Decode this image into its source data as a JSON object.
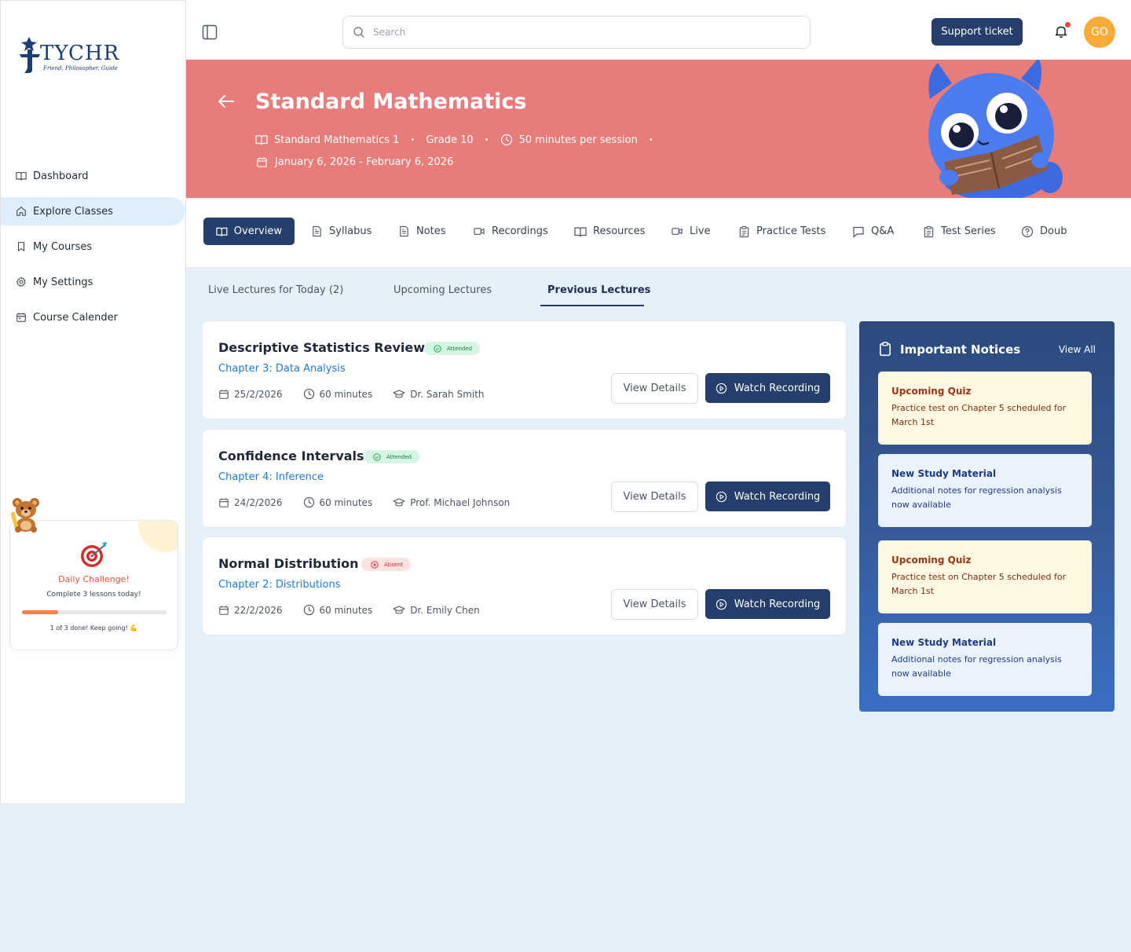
{
  "brand": {
    "name": "TYCHR",
    "tagline": "Friend, Philosopher, Guide"
  },
  "sidebar": {
    "items": [
      {
        "label": "Dashboard",
        "icon": "book-open-icon",
        "active": false
      },
      {
        "label": "Explore Classes",
        "icon": "home-icon",
        "active": true
      },
      {
        "label": "My Courses",
        "icon": "bookmark-icon",
        "active": false
      },
      {
        "label": "My Settings",
        "icon": "gear-icon",
        "active": false
      },
      {
        "label": "Course Calender",
        "icon": "calendar-icon",
        "active": false
      }
    ],
    "challenge": {
      "title": "Daily Challenge!",
      "subtitle": "Complete 3 lessons today!",
      "progress_fraction": 0.25,
      "progress_text": "1 of 3 done! Keep going! 💪"
    }
  },
  "topbar": {
    "search_placeholder": "Search",
    "support_label": "Support ticket",
    "avatar_initials": "GO",
    "notification_dot_color": "#ef4444"
  },
  "hero": {
    "title": "Standard Mathematics",
    "course": "Standard Mathematics 1",
    "grade": "Grade 10",
    "session": "50 minutes per session",
    "date_range": "January 6, 2026 - February 6, 2026",
    "background_color": "#e87c7b"
  },
  "tabs": [
    {
      "label": "Overview",
      "icon": "book-open-icon",
      "active": true
    },
    {
      "label": "Syllabus",
      "icon": "document-icon",
      "active": false
    },
    {
      "label": "Notes",
      "icon": "document-icon",
      "active": false
    },
    {
      "label": "Recordings",
      "icon": "video-icon",
      "active": false
    },
    {
      "label": "Resources",
      "icon": "book-open-icon",
      "active": false
    },
    {
      "label": "Live",
      "icon": "video-icon",
      "active": false
    },
    {
      "label": "Practice Tests",
      "icon": "clipboard-icon",
      "active": false
    },
    {
      "label": "Q&A",
      "icon": "chat-icon",
      "active": false
    },
    {
      "label": "Test Series",
      "icon": "clipboard-icon",
      "active": false
    },
    {
      "label": "Doub",
      "icon": "question-icon",
      "active": false
    }
  ],
  "subtabs": [
    {
      "label": "Live Lectures for Today (2)",
      "active": false
    },
    {
      "label": "Upcoming Lectures",
      "active": false
    },
    {
      "label": "Previous Lectures",
      "active": true
    }
  ],
  "lectures": [
    {
      "title": "Descriptive Statistics Review",
      "status": "Attended",
      "chapter": "Chapter 3: Data Analysis",
      "date": "25/2/2026",
      "duration": "60 minutes",
      "instructor": "Dr. Sarah Smith"
    },
    {
      "title": "Confidence Intervals",
      "status": "Attended",
      "chapter": "Chapter 4: Inference",
      "date": "24/2/2026",
      "duration": "60 minutes",
      "instructor": "Prof. Michael Johnson"
    },
    {
      "title": "Normal Distribution",
      "status": "Absent",
      "chapter": "Chapter 2: Distributions",
      "date": "22/2/2026",
      "duration": "60 minutes",
      "instructor": "Dr. Emily Chen"
    }
  ],
  "lecture_actions": {
    "details_label": "View Details",
    "watch_label": "Watch Recording"
  },
  "notices": {
    "title": "Important Notices",
    "view_all": "View All",
    "items": [
      {
        "type": "quiz",
        "title": "Upcoming Quiz",
        "body": "Practice test on Chapter 5 scheduled for March 1st"
      },
      {
        "type": "material",
        "title": "New Study Material",
        "body": "Additional notes for regression analysis now available"
      },
      {
        "type": "quiz",
        "title": "Upcoming Quiz",
        "body": "Practice test on Chapter 5 scheduled for March 1st"
      },
      {
        "type": "material",
        "title": "New Study Material",
        "body": "Additional notes for regression analysis now available"
      }
    ]
  },
  "colors": {
    "primary": "#263e6c",
    "link": "#1e7ad6",
    "page_bg": "#e4f1fb",
    "accent_orange": "#fbab3a"
  }
}
